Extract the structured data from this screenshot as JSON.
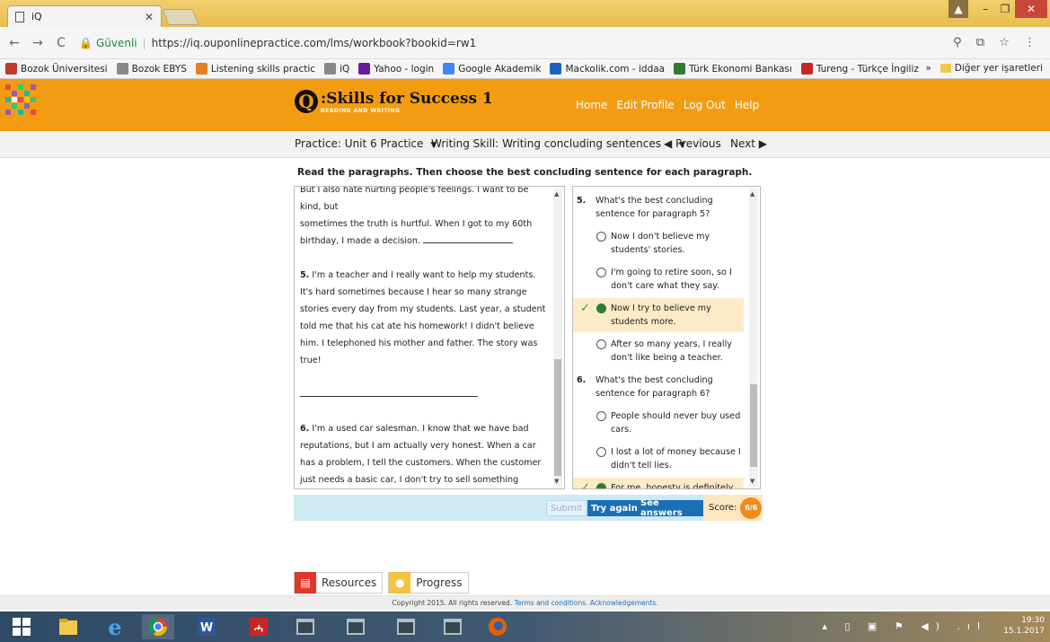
{
  "browser": {
    "tab_title": "iQ",
    "secure_label": "Güvenli",
    "url": "https://iq.ouponlinepractice.com/lms/workbook?bookid=rw1",
    "bookmarks": [
      {
        "label": "Bozok Üniversitesi",
        "icon_color": "#c0392b"
      },
      {
        "label": "Bozok EBYS",
        "icon_color": "#888888"
      },
      {
        "label": "Listening skills practic",
        "icon_color": "#e67e22"
      },
      {
        "label": "iQ",
        "icon_color": "#888888"
      },
      {
        "label": "Yahoo - login",
        "icon_color": "#6a1b9a"
      },
      {
        "label": "Google Akademik",
        "icon_color": "#4285f4"
      },
      {
        "label": "Mackolik.com - iddaa",
        "icon_color": "#1565c0"
      },
      {
        "label": "Türk Ekonomi Bankası",
        "icon_color": "#2e7d32"
      },
      {
        "label": "Tureng - Türkçe İngiliz",
        "icon_color": "#c62828"
      }
    ],
    "bookmarks_overflow": "»",
    "other_bookmarks": "Diğer yer işaretleri"
  },
  "header": {
    "logo_letter": "Q",
    "logo_title": ":Skills for Success 1",
    "logo_subtitle": "READING AND WRITING",
    "nav": [
      "Home",
      "Edit Profile",
      "Log Out",
      "Help"
    ]
  },
  "practice_bar": {
    "practice_select": "Practice: Unit 6 Practice",
    "skill_select": "Writing Skill: Writing concluding sentences",
    "previous": "◀ Previous",
    "next": "Next ▶"
  },
  "instructions": "Read the paragraphs. Then choose the best concluding sentence for each paragraph.",
  "reading": {
    "cut_line": "But I also hate hurting people's feelings. I want to be kind, but",
    "p4_tail": "sometimes the truth is hurtful. When I got to my 60th birthday, I made a decision.",
    "p5_num": "5.",
    "p5_text": "I'm a teacher and I really want to help my students. It's hard sometimes because I hear so many strange stories every day from my students. Last year, a student told me that his cat ate his homework! I didn't believe him. I telephoned his mother and father. The story was true!",
    "p6_num": "6.",
    "p6_text": "I'm a used car salesman. I know that we have bad reputations, but I am actually very honest. When a car has a problem, I tell the customers. When the customer just needs a basic car, I don't try to sell something expensive. Because I'm honest, my business is always good. Many customers come back years later to buy another car."
  },
  "questions": [
    {
      "num": "5.",
      "text": "What's the best concluding sentence for paragraph 5?",
      "options": [
        {
          "text": "Now I don't believe my students' stories.",
          "selected": false,
          "correct": false
        },
        {
          "text": "I'm going to retire soon, so I don't care what they say.",
          "selected": false,
          "correct": false
        },
        {
          "text": "Now I try to believe my students more.",
          "selected": true,
          "correct": true
        },
        {
          "text": "After so many years, I really don't like being a teacher.",
          "selected": false,
          "correct": false
        }
      ]
    },
    {
      "num": "6.",
      "text": "What's the best concluding sentence for paragraph 6?",
      "options": [
        {
          "text": "People should never buy used cars.",
          "selected": false,
          "correct": false
        },
        {
          "text": "I lost a lot of money because I didn't tell lies.",
          "selected": false,
          "correct": false
        },
        {
          "text": "For me, honesty is definitely the",
          "selected": true,
          "correct": true
        }
      ]
    }
  ],
  "actions": {
    "submit": "Submit",
    "try_again": "Try again",
    "see_answers": "See answers",
    "score_label": "Score:",
    "score_value": "6/6"
  },
  "footer_tabs": {
    "resources": "Resources",
    "progress": "Progress"
  },
  "copyright": {
    "text": "Copyright 2015. All rights reserved.",
    "terms": "Terms and conditions.",
    "ack": "Acknowledgements."
  },
  "taskbar": {
    "time": "19:30",
    "date": "15.1.2017"
  },
  "colors": {
    "header_orange": "#f39c12",
    "button_blue": "#1a6fb5",
    "correct_highlight": "#fdebc8",
    "action_bar": "#cdeaf3"
  }
}
